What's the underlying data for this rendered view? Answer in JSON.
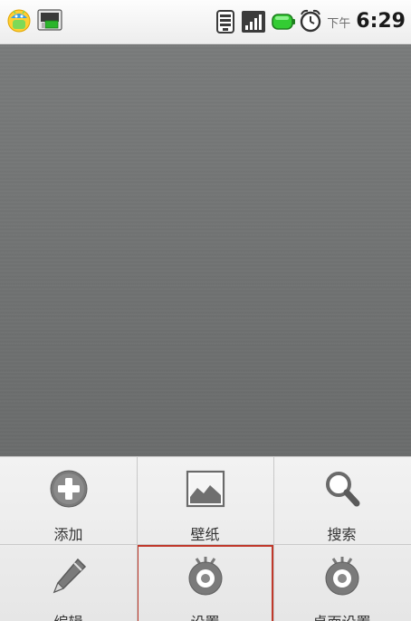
{
  "status_bar": {
    "notifications": [
      {
        "icon": "android-notification-icon"
      },
      {
        "icon": "sim-card-notification-icon"
      }
    ],
    "wifi_icon": "wifi-icon",
    "signal_icon": "signal-strength-icon",
    "battery_icon": "battery-icon",
    "battery_color": "#33cc33",
    "alarm_icon": "alarm-clock-icon",
    "clock": {
      "ampm": "下午",
      "time": "6:29"
    }
  },
  "wallpaper": {
    "color": "#6d6f6e"
  },
  "options_menu": {
    "selected": "settings",
    "selection_border_color": "#c0392b",
    "items": [
      {
        "id": "add",
        "label": "添加",
        "icon": "add-icon"
      },
      {
        "id": "wallpaper",
        "label": "壁纸",
        "icon": "wallpaper-icon"
      },
      {
        "id": "search",
        "label": "搜索",
        "icon": "search-icon"
      },
      {
        "id": "edit",
        "label": "编辑",
        "icon": "pencil-icon"
      },
      {
        "id": "settings",
        "label": "设置",
        "icon": "settings-icon"
      },
      {
        "id": "desktop_settings",
        "label": "桌面设置",
        "icon": "settings-icon"
      }
    ]
  }
}
